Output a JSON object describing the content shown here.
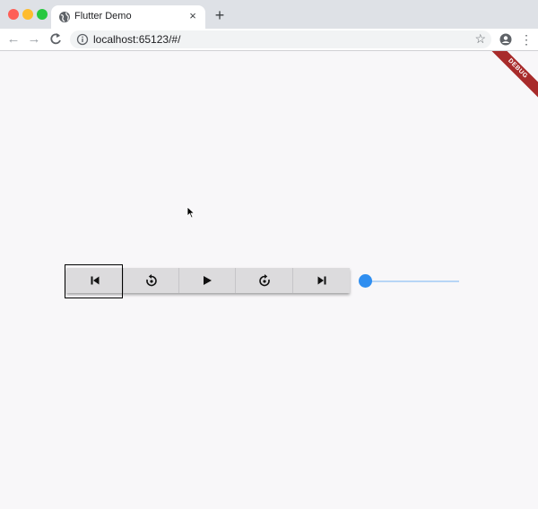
{
  "browser": {
    "tab_title": "Flutter Demo",
    "tab_close": "×",
    "new_tab": "+",
    "url": "localhost:65123/#/",
    "icons": {
      "back": "arrow-left-icon",
      "forward": "arrow-right-icon",
      "reload": "reload-icon",
      "info": "info-icon",
      "star": "star-icon",
      "profile": "profile-icon",
      "menu": "menu-icon",
      "globe": "globe-icon"
    }
  },
  "debug_banner": {
    "label": "DEBUG"
  },
  "media_controls": {
    "buttons": [
      {
        "name": "skip-previous-button",
        "icon": "skip-previous-icon"
      },
      {
        "name": "replay-5-button",
        "icon": "replay-5-icon"
      },
      {
        "name": "play-button",
        "icon": "play-icon"
      },
      {
        "name": "forward-5-button",
        "icon": "forward-5-icon"
      },
      {
        "name": "skip-next-button",
        "icon": "skip-next-icon"
      }
    ],
    "slider": {
      "value": 0,
      "color": "#2f8ef0",
      "track_color": "#b7d5f6"
    }
  }
}
